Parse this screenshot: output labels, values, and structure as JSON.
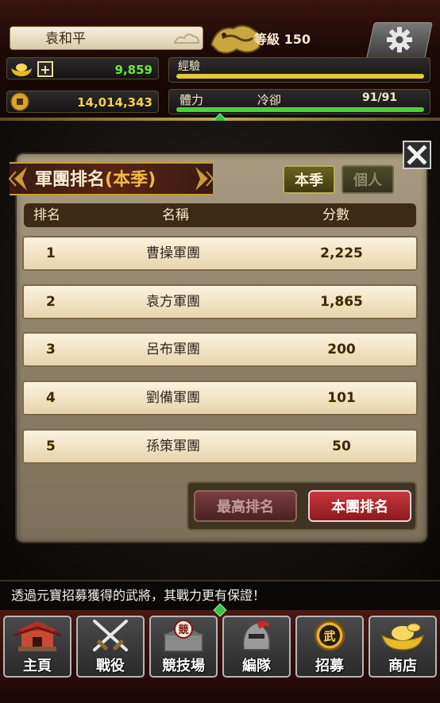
{
  "player": {
    "name": "袁和平",
    "level_label": "等級 150",
    "gold": "9,859",
    "copper": "14,014,343"
  },
  "status": {
    "exp_label": "經驗",
    "stamina_label": "體力",
    "cooldown_label": "冷卻",
    "stamina_value": "91/91",
    "exp_fill": 1.0,
    "stamina_fill": 1.0
  },
  "panel": {
    "title": "軍團排名",
    "title_sub": "(本季)",
    "tabs": [
      "本季",
      "個人"
    ],
    "headers": {
      "rank": "排名",
      "name": "名稱",
      "score": "分數"
    },
    "rows": [
      {
        "rank": "1",
        "name": "曹操軍團",
        "score": "2,225"
      },
      {
        "rank": "2",
        "name": "袁方軍團",
        "score": "1,865"
      },
      {
        "rank": "3",
        "name": "呂布軍團",
        "score": "200"
      },
      {
        "rank": "4",
        "name": "劉備軍團",
        "score": "101"
      },
      {
        "rank": "5",
        "name": "孫策軍團",
        "score": "50"
      }
    ],
    "buttons": {
      "best_rank": "最高排名",
      "my_rank": "本團排名"
    }
  },
  "tip": "透過元寶招募獲得的武將，其戰力更有保證！",
  "nav": [
    "主頁",
    "戰役",
    "競技場",
    "編隊",
    "招募",
    "商店"
  ],
  "icons": {
    "settings": "gear-icon",
    "gold": "gold-ingot-icon",
    "copper": "coin-icon",
    "close": "close-icon"
  },
  "colors": {
    "gold_value": "#6fe63a",
    "copper_value": "#f1d14d",
    "exp_bar": "#e9c53a",
    "stamina_bar": "#4bd23a",
    "active_button": "#c8373d"
  }
}
